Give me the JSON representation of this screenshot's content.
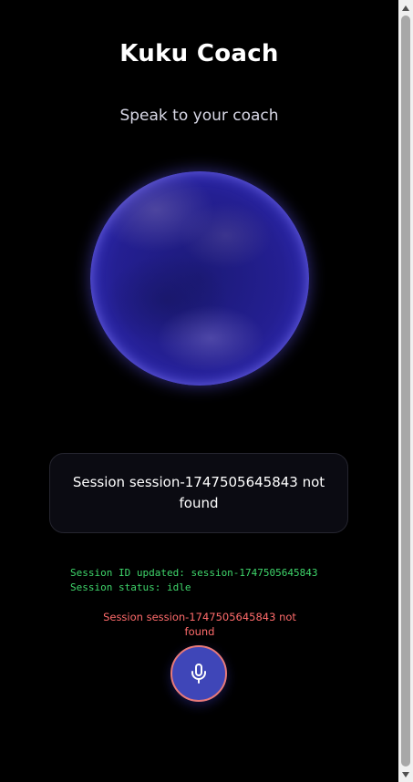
{
  "app": {
    "title": "Kuku Coach",
    "subtitle": "Speak to your coach"
  },
  "status_card": {
    "message": "Session session-1747505645843 not found"
  },
  "debug": {
    "session_id_line": "Session ID updated: session-1747505645843",
    "session_status_line": "Session status: idle"
  },
  "error": {
    "message": "Session session-1747505645843 not found"
  },
  "mic_button": {
    "icon": "microphone-icon"
  },
  "colors": {
    "background": "#000000",
    "orb": "#241f92",
    "debug_text": "#3fd66b",
    "error_text": "#ff6b6b",
    "mic_button": "#3f46b8",
    "mic_border": "#e87a7a"
  }
}
